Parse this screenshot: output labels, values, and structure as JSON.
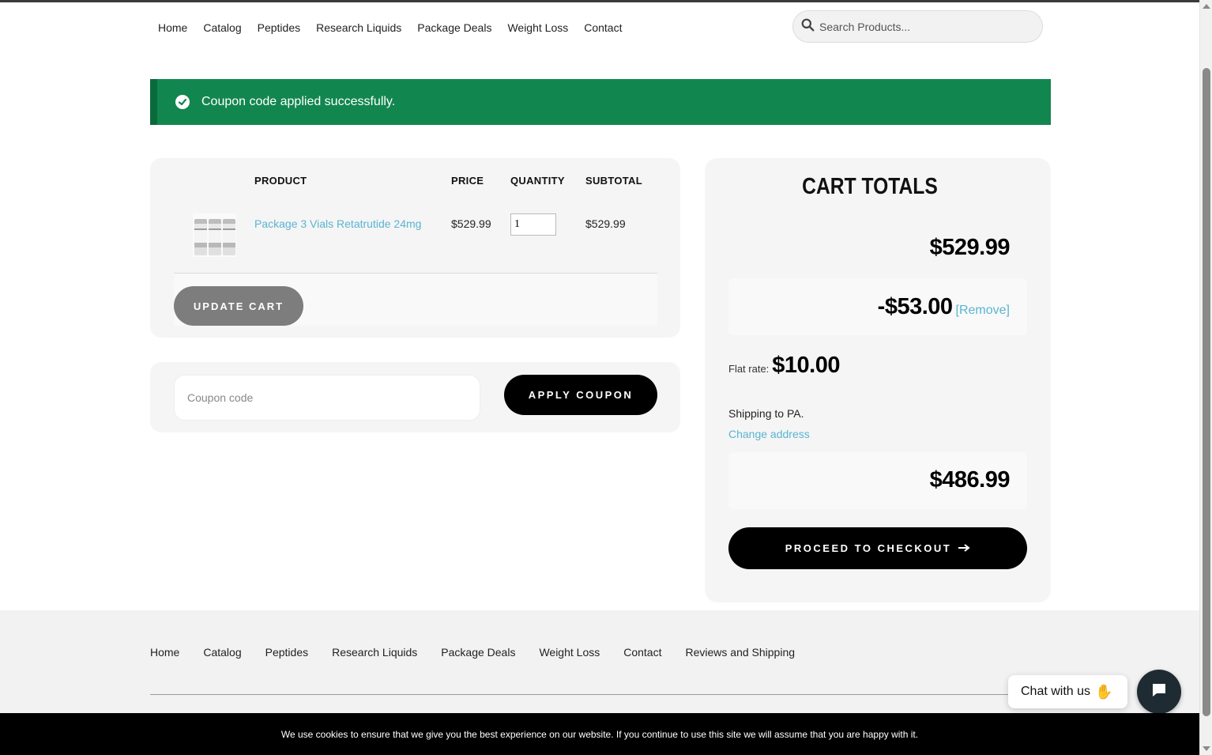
{
  "nav": {
    "items": [
      "Home",
      "Catalog",
      "Peptides",
      "Research Liquids",
      "Package Deals",
      "Weight Loss",
      "Contact"
    ]
  },
  "search": {
    "placeholder": "Search Products..."
  },
  "notice": {
    "message": "Coupon code applied successfully."
  },
  "cart": {
    "headers": {
      "product": "PRODUCT",
      "price": "PRICE",
      "quantity": "QUANTITY",
      "subtotal": "SUBTOTAL"
    },
    "rows": [
      {
        "name": "Package 3 Vials Retatrutide 24mg",
        "price": "$529.99",
        "quantity": "1",
        "subtotal": "$529.99"
      }
    ],
    "update_label": "UPDATE CART"
  },
  "coupon": {
    "placeholder": "Coupon code",
    "apply_label": "APPLY COUPON"
  },
  "totals": {
    "title": "CART TOTALS",
    "subtotal": "$529.99",
    "discount": "-$53.00",
    "remove_label": "[Remove]",
    "flat_rate_label": "Flat rate:",
    "flat_rate_value": "$10.00",
    "shipping_to": "Shipping to PA.",
    "change_address": "Change address",
    "total": "$486.99",
    "checkout_label": "PROCEED TO CHECKOUT",
    "checkout_icon": "arrow-right-icon"
  },
  "footer": {
    "items": [
      "Home",
      "Catalog",
      "Peptides",
      "Research Liquids",
      "Package Deals",
      "Weight Loss",
      "Contact",
      "Reviews and Shipping"
    ]
  },
  "chat": {
    "label": "Chat with us",
    "wave_icon": "waving-hand-icon",
    "button_icon": "chat-icon"
  },
  "cookie": {
    "text": "We use cookies to ensure that we give you the best experience on our website. If you continue to use this site we will assume that you are happy with it."
  },
  "colors": {
    "notice": "#12864f",
    "link": "#5ab4d2",
    "primary_button": "#000000",
    "update_button": "#7d7d7d"
  }
}
